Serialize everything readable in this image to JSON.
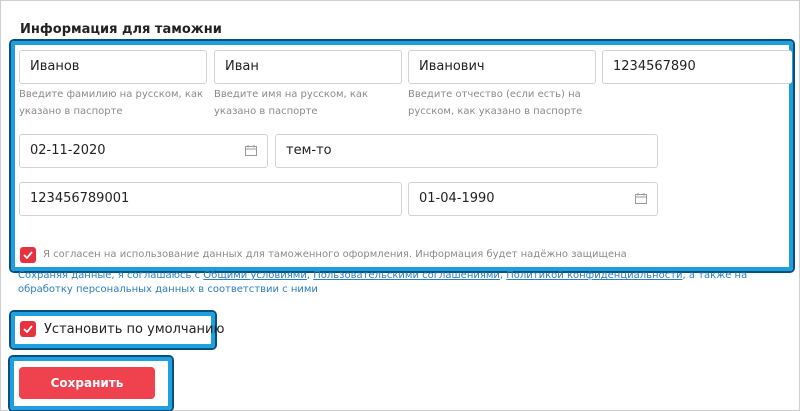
{
  "section_title": "Информация для таможни",
  "fields": {
    "last_name": {
      "value": "Иванов",
      "hint": "Введите фамилию на русском, как указано в паспорте"
    },
    "first_name": {
      "value": "Иван",
      "hint": "Введите имя на русском, как указано в паспорте"
    },
    "patronymic": {
      "value": "Иванович",
      "hint": "Введите отчество (если есть) на русском, как указано в паспорте"
    },
    "phone": {
      "value": "1234567890"
    },
    "passport_issue_date": {
      "value": "02-11-2020"
    },
    "issued_by": {
      "value": "тем-то"
    },
    "inn": {
      "value": "123456789001"
    },
    "birth_date": {
      "value": "01-04-1990"
    }
  },
  "consent": {
    "label": "Я согласен на использование данных для таможенного оформления. Информация будет надёжно защищена",
    "checked": true
  },
  "terms": {
    "prefix": "Сохраняя данные, я соглашаюсь с ",
    "link1": "Общими условиями",
    "sep1": ", ",
    "link2": "Пользовательскими соглашениями",
    "sep2": ", ",
    "link3": "Политикой конфиденциальности",
    "suffix": ", а также на обработку персональных данных в соответствии с ними"
  },
  "default_option": {
    "label": "Установить по умолчанию",
    "checked": true
  },
  "save_button": {
    "label": "Сохранить"
  },
  "colors": {
    "accent_red": "#f0414f",
    "highlight_blue": "#1e9fe0",
    "link_blue": "#2a7fc1"
  }
}
